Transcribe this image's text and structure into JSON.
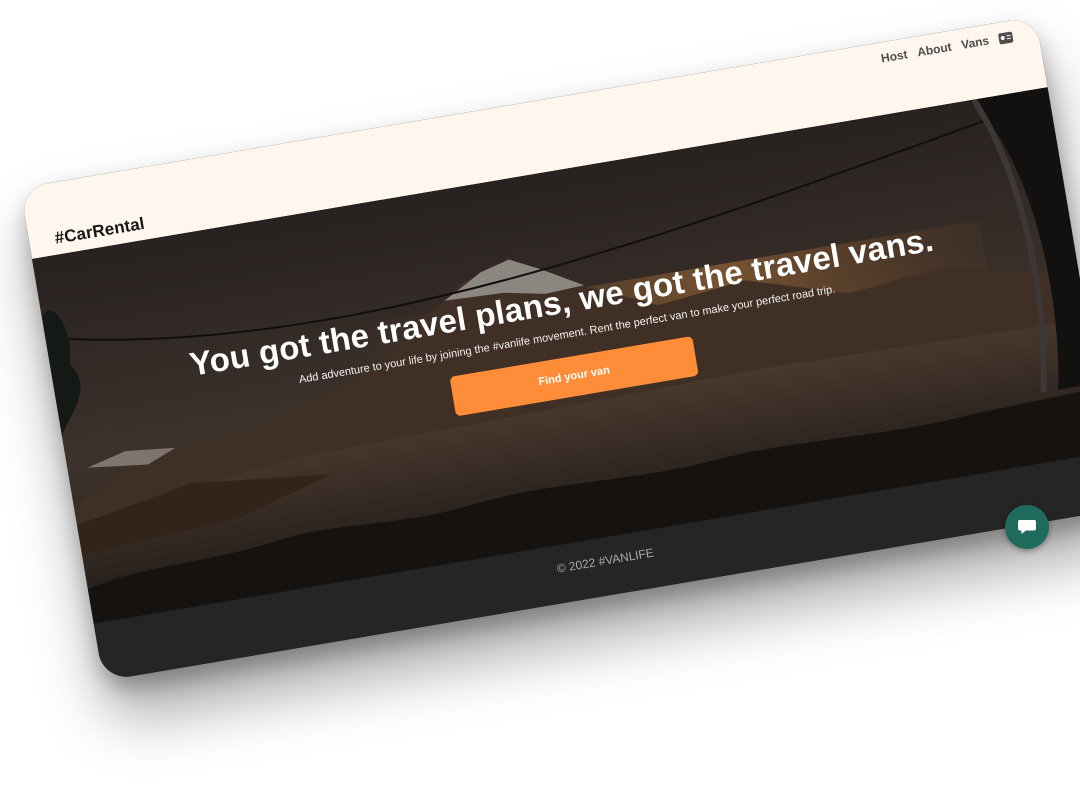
{
  "navbar": {
    "brand": "#CarRental",
    "links": [
      "Host",
      "About",
      "Vans"
    ],
    "user_icon": "user-card-icon"
  },
  "hero": {
    "title": "You got the travel plans, we got the travel vans.",
    "subtitle": "Add adventure to your life by joining the #vanlife movement. Rent the perfect van to make your perfect road trip.",
    "cta_label": "Find your van",
    "cta_color": "#ff8c38"
  },
  "footer": {
    "text": "© 2022 #VANLIFE"
  },
  "chat": {
    "icon": "chat-bubble-icon",
    "color": "#1e6b5e"
  },
  "colors": {
    "navbar_bg": "#fff7ed",
    "footer_bg": "#252525"
  }
}
